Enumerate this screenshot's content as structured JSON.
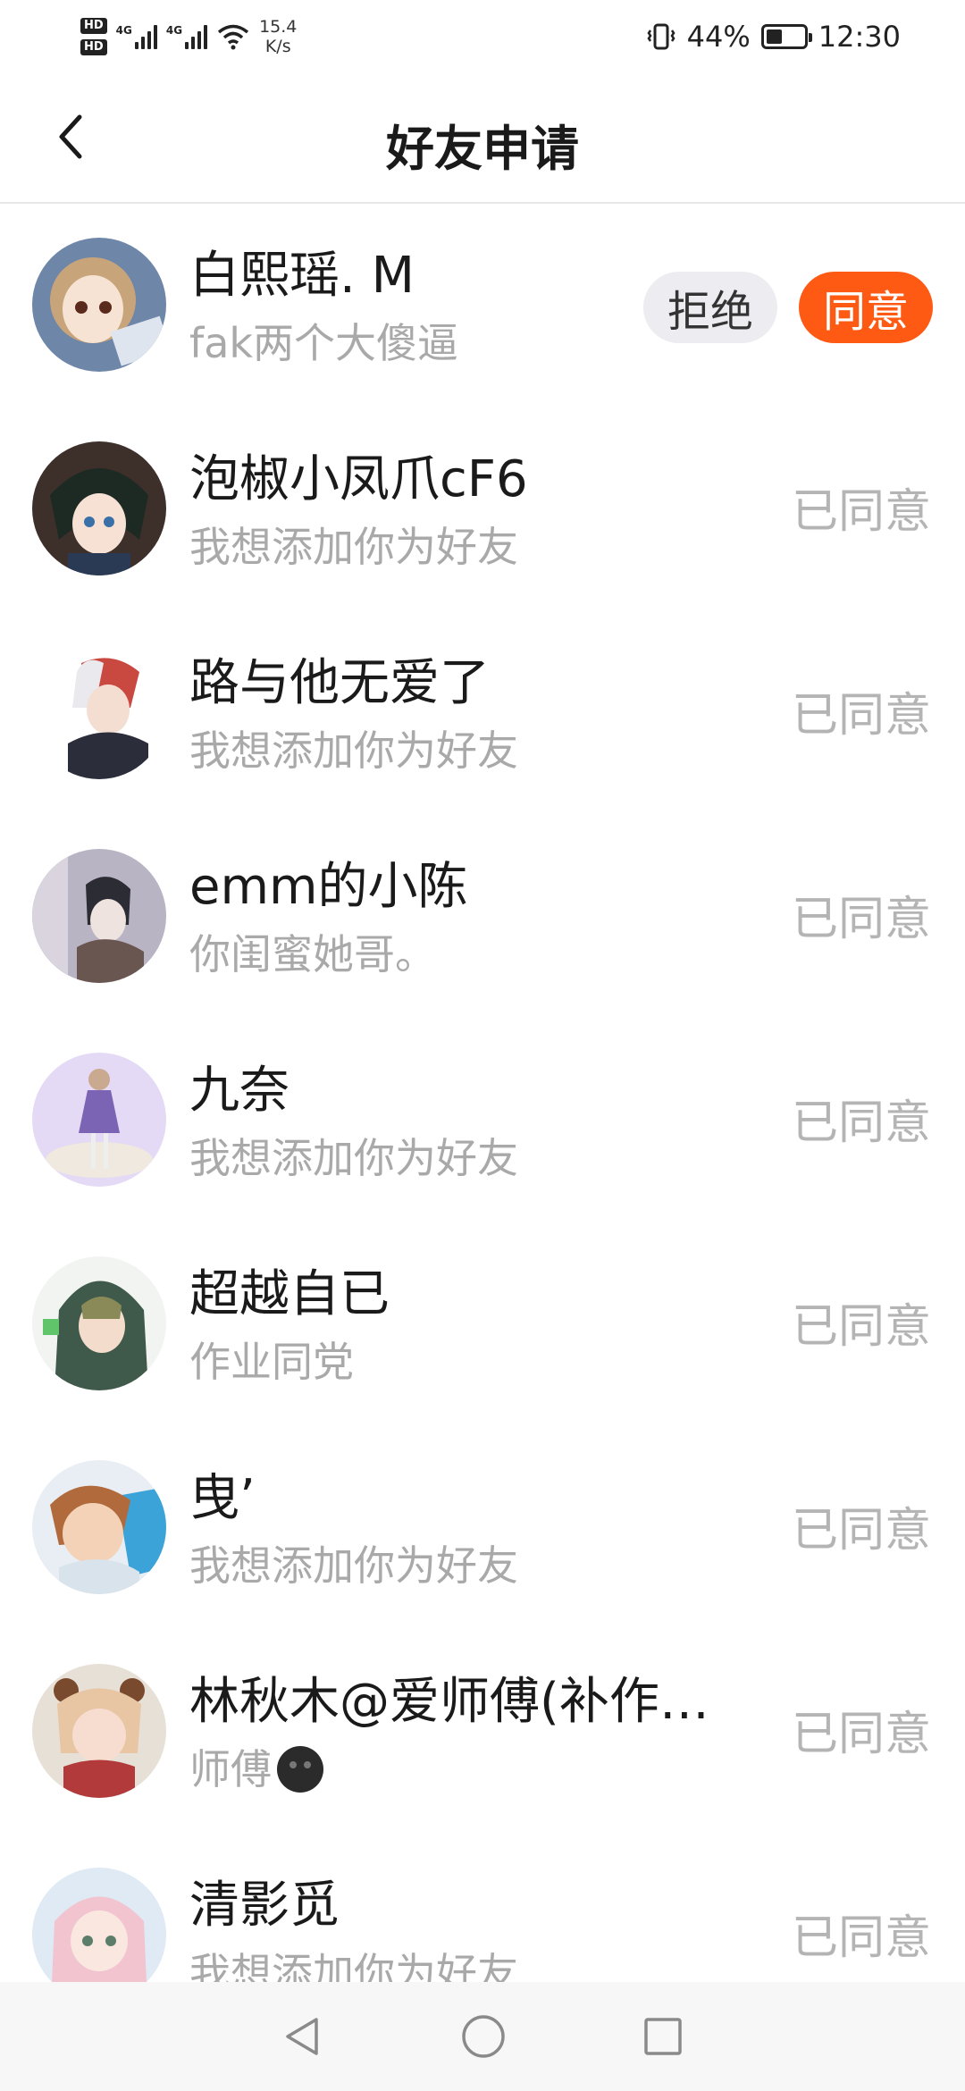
{
  "status_bar": {
    "hd1": "HD",
    "hd2": "HD",
    "net1": "4G",
    "net2": "4G",
    "speed_value": "15.4",
    "speed_unit": "K/s",
    "battery_percent": "44%",
    "battery_level": 0.44,
    "time": "12:30"
  },
  "header": {
    "title": "好友申请",
    "back_icon": "chevron-left-icon"
  },
  "requests": {
    "items": [
      {
        "name": "白熙瑶. M",
        "message": "fak两个大傻逼",
        "state": "pending"
      },
      {
        "name": "泡椒小凤爪cF6",
        "message": "我想添加你为好友",
        "state": "已同意"
      },
      {
        "name": "路与他无爱了",
        "message": "我想添加你为好友",
        "state": "已同意"
      },
      {
        "name": "emm的小陈",
        "message": "你闺蜜她哥。",
        "state": "已同意"
      },
      {
        "name": "九奈",
        "message": "我想添加你为好友",
        "state": "已同意"
      },
      {
        "name": "超越自已",
        "message": "作业同党",
        "state": "已同意"
      },
      {
        "name": "曳’",
        "message": "我想添加你为好友",
        "state": "已同意"
      },
      {
        "name": "林秋木@爱师傅(补作…",
        "message": "师傅",
        "state": "已同意",
        "message_emoji": "dark-smiley-emoji"
      },
      {
        "name": "清影觅",
        "message": "我想添加你为好友",
        "state": "已同意"
      }
    ],
    "reject_label": "拒绝",
    "accept_label": "同意"
  },
  "colors": {
    "accent": "#ff5a14",
    "reject_bg": "#ececf1",
    "muted_text": "#a9a9a9",
    "status_text": "#b4b4b4"
  },
  "nav_bar": {
    "back_icon": "triangle-back-icon",
    "home_icon": "circle-home-icon",
    "recents_icon": "square-recents-icon"
  }
}
